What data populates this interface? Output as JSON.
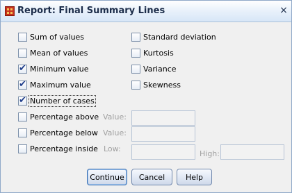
{
  "window": {
    "title": "Report: Final Summary Lines",
    "close_glyph": "×"
  },
  "options": {
    "sum_of_values": {
      "label": "Sum of values",
      "checked": false
    },
    "mean_of_values": {
      "label": "Mean of values",
      "checked": false
    },
    "minimum_value": {
      "label": "Minimum value",
      "checked": true
    },
    "maximum_value": {
      "label": "Maximum value",
      "checked": true
    },
    "number_of_cases": {
      "label": "Number of cases",
      "checked": true
    },
    "percentage_above": {
      "label": "Percentage above",
      "checked": false,
      "value_label": "Value:",
      "value": ""
    },
    "percentage_below": {
      "label": "Percentage below",
      "checked": false,
      "value_label": "Value:",
      "value": ""
    },
    "percentage_inside": {
      "label": "Percentage inside",
      "checked": false,
      "low_label": "Low:",
      "low": "",
      "high_label": "High:",
      "high": ""
    },
    "standard_deviation": {
      "label": "Standard deviation",
      "checked": false
    },
    "kurtosis": {
      "label": "Kurtosis",
      "checked": false
    },
    "variance": {
      "label": "Variance",
      "checked": false
    },
    "skewness": {
      "label": "Skewness",
      "checked": false
    }
  },
  "buttons": {
    "continue": "Continue",
    "cancel": "Cancel",
    "help": "Help"
  },
  "colors": {
    "dialog_bg": "#f0f0f0",
    "check_mark": "#1f3d8a",
    "disabled_text": "#a0a0a0"
  }
}
